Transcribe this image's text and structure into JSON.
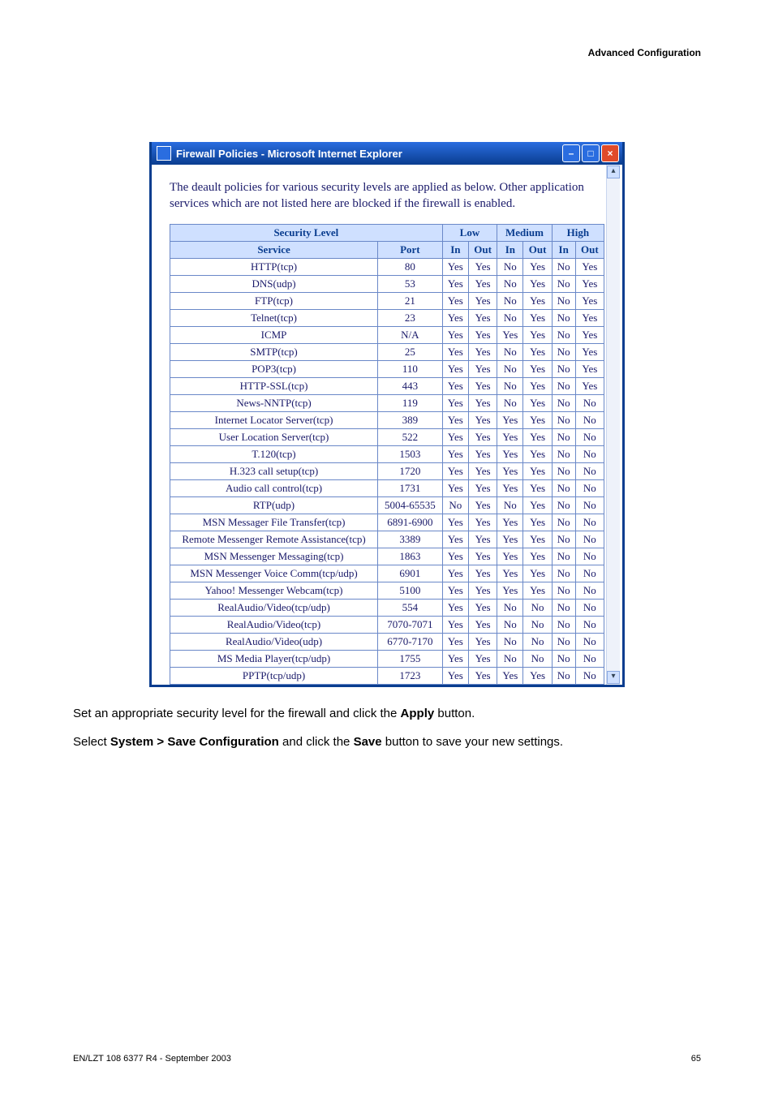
{
  "header": {
    "right": "Advanced Configuration"
  },
  "window": {
    "title": "Firewall Policies - Microsoft Internet Explorer",
    "minimize": "–",
    "maximize": "□",
    "close": "×"
  },
  "intro": "The deault policies for various security levels are applied as below. Other application services which are not listed here are blocked if the firewall is enabled.",
  "headers": {
    "security_level": "Security Level",
    "low": "Low",
    "medium": "Medium",
    "high": "High",
    "service": "Service",
    "port": "Port",
    "in": "In",
    "out": "Out"
  },
  "rows": [
    {
      "svc": "HTTP(tcp)",
      "port": "80",
      "li": "Yes",
      "lo": "Yes",
      "mi": "No",
      "mo": "Yes",
      "hi": "No",
      "ho": "Yes"
    },
    {
      "svc": "DNS(udp)",
      "port": "53",
      "li": "Yes",
      "lo": "Yes",
      "mi": "No",
      "mo": "Yes",
      "hi": "No",
      "ho": "Yes"
    },
    {
      "svc": "FTP(tcp)",
      "port": "21",
      "li": "Yes",
      "lo": "Yes",
      "mi": "No",
      "mo": "Yes",
      "hi": "No",
      "ho": "Yes"
    },
    {
      "svc": "Telnet(tcp)",
      "port": "23",
      "li": "Yes",
      "lo": "Yes",
      "mi": "No",
      "mo": "Yes",
      "hi": "No",
      "ho": "Yes"
    },
    {
      "svc": "ICMP",
      "port": "N/A",
      "li": "Yes",
      "lo": "Yes",
      "mi": "Yes",
      "mo": "Yes",
      "hi": "No",
      "ho": "Yes"
    },
    {
      "svc": "SMTP(tcp)",
      "port": "25",
      "li": "Yes",
      "lo": "Yes",
      "mi": "No",
      "mo": "Yes",
      "hi": "No",
      "ho": "Yes"
    },
    {
      "svc": "POP3(tcp)",
      "port": "110",
      "li": "Yes",
      "lo": "Yes",
      "mi": "No",
      "mo": "Yes",
      "hi": "No",
      "ho": "Yes"
    },
    {
      "svc": "HTTP-SSL(tcp)",
      "port": "443",
      "li": "Yes",
      "lo": "Yes",
      "mi": "No",
      "mo": "Yes",
      "hi": "No",
      "ho": "Yes"
    },
    {
      "svc": "News-NNTP(tcp)",
      "port": "119",
      "li": "Yes",
      "lo": "Yes",
      "mi": "No",
      "mo": "Yes",
      "hi": "No",
      "ho": "No"
    },
    {
      "svc": "Internet Locator Server(tcp)",
      "port": "389",
      "li": "Yes",
      "lo": "Yes",
      "mi": "Yes",
      "mo": "Yes",
      "hi": "No",
      "ho": "No"
    },
    {
      "svc": "User Location Server(tcp)",
      "port": "522",
      "li": "Yes",
      "lo": "Yes",
      "mi": "Yes",
      "mo": "Yes",
      "hi": "No",
      "ho": "No"
    },
    {
      "svc": "T.120(tcp)",
      "port": "1503",
      "li": "Yes",
      "lo": "Yes",
      "mi": "Yes",
      "mo": "Yes",
      "hi": "No",
      "ho": "No"
    },
    {
      "svc": "H.323 call setup(tcp)",
      "port": "1720",
      "li": "Yes",
      "lo": "Yes",
      "mi": "Yes",
      "mo": "Yes",
      "hi": "No",
      "ho": "No"
    },
    {
      "svc": "Audio call control(tcp)",
      "port": "1731",
      "li": "Yes",
      "lo": "Yes",
      "mi": "Yes",
      "mo": "Yes",
      "hi": "No",
      "ho": "No"
    },
    {
      "svc": "RTP(udp)",
      "port": "5004-65535",
      "li": "No",
      "lo": "Yes",
      "mi": "No",
      "mo": "Yes",
      "hi": "No",
      "ho": "No"
    },
    {
      "svc": "MSN Messager File Transfer(tcp)",
      "port": "6891-6900",
      "li": "Yes",
      "lo": "Yes",
      "mi": "Yes",
      "mo": "Yes",
      "hi": "No",
      "ho": "No"
    },
    {
      "svc": "Remote Messenger Remote Assistance(tcp)",
      "port": "3389",
      "li": "Yes",
      "lo": "Yes",
      "mi": "Yes",
      "mo": "Yes",
      "hi": "No",
      "ho": "No"
    },
    {
      "svc": "MSN Messenger Messaging(tcp)",
      "port": "1863",
      "li": "Yes",
      "lo": "Yes",
      "mi": "Yes",
      "mo": "Yes",
      "hi": "No",
      "ho": "No"
    },
    {
      "svc": "MSN Messenger Voice Comm(tcp/udp)",
      "port": "6901",
      "li": "Yes",
      "lo": "Yes",
      "mi": "Yes",
      "mo": "Yes",
      "hi": "No",
      "ho": "No"
    },
    {
      "svc": "Yahoo! Messenger Webcam(tcp)",
      "port": "5100",
      "li": "Yes",
      "lo": "Yes",
      "mi": "Yes",
      "mo": "Yes",
      "hi": "No",
      "ho": "No"
    },
    {
      "svc": "RealAudio/Video(tcp/udp)",
      "port": "554",
      "li": "Yes",
      "lo": "Yes",
      "mi": "No",
      "mo": "No",
      "hi": "No",
      "ho": "No"
    },
    {
      "svc": "RealAudio/Video(tcp)",
      "port": "7070-7071",
      "li": "Yes",
      "lo": "Yes",
      "mi": "No",
      "mo": "No",
      "hi": "No",
      "ho": "No"
    },
    {
      "svc": "RealAudio/Video(udp)",
      "port": "6770-7170",
      "li": "Yes",
      "lo": "Yes",
      "mi": "No",
      "mo": "No",
      "hi": "No",
      "ho": "No"
    },
    {
      "svc": "MS Media Player(tcp/udp)",
      "port": "1755",
      "li": "Yes",
      "lo": "Yes",
      "mi": "No",
      "mo": "No",
      "hi": "No",
      "ho": "No"
    },
    {
      "svc": "PPTP(tcp/udp)",
      "port": "1723",
      "li": "Yes",
      "lo": "Yes",
      "mi": "Yes",
      "mo": "Yes",
      "hi": "No",
      "ho": "No"
    }
  ],
  "body": {
    "p1_a": "Set an appropriate security level for the firewall and click the ",
    "p1_b": "Apply",
    "p1_c": " button.",
    "p2_a": "Select ",
    "p2_b": "System > Save Configuration",
    "p2_c": " and click the ",
    "p2_d": "Save",
    "p2_e": " button to save your new settings."
  },
  "footer": {
    "left": "EN/LZT 108 6377 R4 - September 2003",
    "right": "65"
  },
  "chart_data": {
    "type": "table",
    "title": "Default firewall policies per security level",
    "columns": [
      "Service",
      "Port",
      "Low In",
      "Low Out",
      "Medium In",
      "Medium Out",
      "High In",
      "High Out"
    ],
    "rows": [
      [
        "HTTP(tcp)",
        "80",
        "Yes",
        "Yes",
        "No",
        "Yes",
        "No",
        "Yes"
      ],
      [
        "DNS(udp)",
        "53",
        "Yes",
        "Yes",
        "No",
        "Yes",
        "No",
        "Yes"
      ],
      [
        "FTP(tcp)",
        "21",
        "Yes",
        "Yes",
        "No",
        "Yes",
        "No",
        "Yes"
      ],
      [
        "Telnet(tcp)",
        "23",
        "Yes",
        "Yes",
        "No",
        "Yes",
        "No",
        "Yes"
      ],
      [
        "ICMP",
        "N/A",
        "Yes",
        "Yes",
        "Yes",
        "Yes",
        "No",
        "Yes"
      ],
      [
        "SMTP(tcp)",
        "25",
        "Yes",
        "Yes",
        "No",
        "Yes",
        "No",
        "Yes"
      ],
      [
        "POP3(tcp)",
        "110",
        "Yes",
        "Yes",
        "No",
        "Yes",
        "No",
        "Yes"
      ],
      [
        "HTTP-SSL(tcp)",
        "443",
        "Yes",
        "Yes",
        "No",
        "Yes",
        "No",
        "Yes"
      ],
      [
        "News-NNTP(tcp)",
        "119",
        "Yes",
        "Yes",
        "No",
        "Yes",
        "No",
        "No"
      ],
      [
        "Internet Locator Server(tcp)",
        "389",
        "Yes",
        "Yes",
        "Yes",
        "Yes",
        "No",
        "No"
      ],
      [
        "User Location Server(tcp)",
        "522",
        "Yes",
        "Yes",
        "Yes",
        "Yes",
        "No",
        "No"
      ],
      [
        "T.120(tcp)",
        "1503",
        "Yes",
        "Yes",
        "Yes",
        "Yes",
        "No",
        "No"
      ],
      [
        "H.323 call setup(tcp)",
        "1720",
        "Yes",
        "Yes",
        "Yes",
        "Yes",
        "No",
        "No"
      ],
      [
        "Audio call control(tcp)",
        "1731",
        "Yes",
        "Yes",
        "Yes",
        "Yes",
        "No",
        "No"
      ],
      [
        "RTP(udp)",
        "5004-65535",
        "No",
        "Yes",
        "No",
        "Yes",
        "No",
        "No"
      ],
      [
        "MSN Messager File Transfer(tcp)",
        "6891-6900",
        "Yes",
        "Yes",
        "Yes",
        "Yes",
        "No",
        "No"
      ],
      [
        "Remote Messenger Remote Assistance(tcp)",
        "3389",
        "Yes",
        "Yes",
        "Yes",
        "Yes",
        "No",
        "No"
      ],
      [
        "MSN Messenger Messaging(tcp)",
        "1863",
        "Yes",
        "Yes",
        "Yes",
        "Yes",
        "No",
        "No"
      ],
      [
        "MSN Messenger Voice Comm(tcp/udp)",
        "6901",
        "Yes",
        "Yes",
        "Yes",
        "Yes",
        "No",
        "No"
      ],
      [
        "Yahoo! Messenger Webcam(tcp)",
        "5100",
        "Yes",
        "Yes",
        "Yes",
        "Yes",
        "No",
        "No"
      ],
      [
        "RealAudio/Video(tcp/udp)",
        "554",
        "Yes",
        "Yes",
        "No",
        "No",
        "No",
        "No"
      ],
      [
        "RealAudio/Video(tcp)",
        "7070-7071",
        "Yes",
        "Yes",
        "No",
        "No",
        "No",
        "No"
      ],
      [
        "RealAudio/Video(udp)",
        "6770-7170",
        "Yes",
        "Yes",
        "No",
        "No",
        "No",
        "No"
      ],
      [
        "MS Media Player(tcp/udp)",
        "1755",
        "Yes",
        "Yes",
        "No",
        "No",
        "No",
        "No"
      ],
      [
        "PPTP(tcp/udp)",
        "1723",
        "Yes",
        "Yes",
        "Yes",
        "Yes",
        "No",
        "No"
      ]
    ]
  }
}
